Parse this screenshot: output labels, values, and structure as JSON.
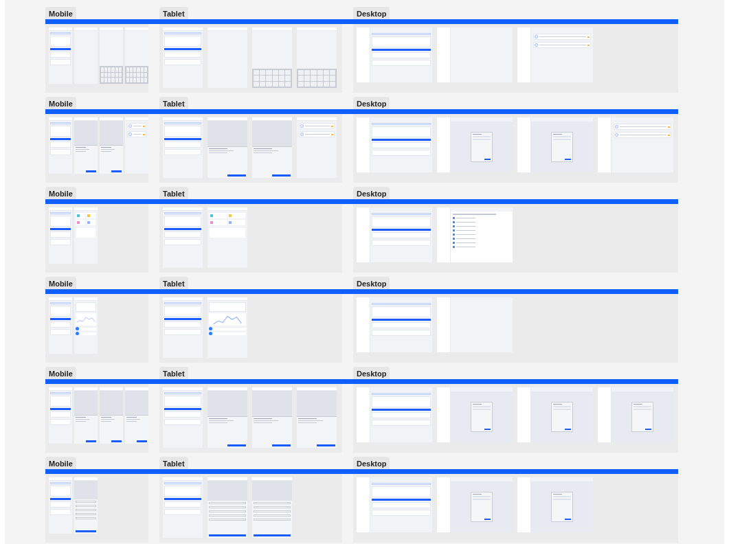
{
  "rows": [
    {
      "sections": [
        {
          "label": "Mobile",
          "kind": "mobile",
          "frames": [
            {
              "kind": "list"
            },
            {
              "kind": "empty"
            },
            {
              "kind": "keyboard"
            },
            {
              "kind": "keyboard"
            }
          ]
        },
        {
          "label": "Tablet",
          "kind": "tablet",
          "frames": [
            {
              "kind": "list"
            },
            {
              "kind": "empty"
            },
            {
              "kind": "keyboard"
            },
            {
              "kind": "keyboard"
            }
          ]
        },
        {
          "label": "Desktop",
          "kind": "desktop",
          "frames": [
            {
              "kind": "list"
            },
            {
              "kind": "empty"
            },
            {
              "kind": "results"
            }
          ]
        }
      ]
    },
    {
      "sections": [
        {
          "label": "Mobile",
          "kind": "mobile",
          "frames": [
            {
              "kind": "list"
            },
            {
              "kind": "sheet"
            },
            {
              "kind": "sheet"
            },
            {
              "kind": "results"
            }
          ]
        },
        {
          "label": "Tablet",
          "kind": "tablet",
          "frames": [
            {
              "kind": "list"
            },
            {
              "kind": "sheet"
            },
            {
              "kind": "sheet"
            },
            {
              "kind": "results"
            }
          ]
        },
        {
          "label": "Desktop",
          "kind": "desktop",
          "frames": [
            {
              "kind": "list"
            },
            {
              "kind": "dialog"
            },
            {
              "kind": "dialog"
            },
            {
              "kind": "results"
            }
          ]
        }
      ]
    },
    {
      "sections": [
        {
          "label": "Mobile",
          "kind": "mobile",
          "frames": [
            {
              "kind": "list"
            },
            {
              "kind": "home"
            }
          ]
        },
        {
          "label": "Tablet",
          "kind": "tablet",
          "frames": [
            {
              "kind": "list"
            },
            {
              "kind": "home"
            }
          ]
        },
        {
          "label": "Desktop",
          "kind": "desktop",
          "frames": [
            {
              "kind": "list"
            },
            {
              "kind": "document"
            }
          ]
        }
      ]
    },
    {
      "sections": [
        {
          "label": "Mobile",
          "kind": "mobile",
          "frames": [
            {
              "kind": "list"
            },
            {
              "kind": "chart"
            }
          ]
        },
        {
          "label": "Tablet",
          "kind": "tablet",
          "frames": [
            {
              "kind": "list"
            },
            {
              "kind": "chart"
            }
          ]
        },
        {
          "label": "Desktop",
          "kind": "desktop",
          "frames": [
            {
              "kind": "list"
            },
            {
              "kind": "blank"
            }
          ]
        }
      ]
    },
    {
      "sections": [
        {
          "label": "Mobile",
          "kind": "mobile",
          "frames": [
            {
              "kind": "list"
            },
            {
              "kind": "sheet"
            },
            {
              "kind": "sheet"
            },
            {
              "kind": "sheet"
            }
          ]
        },
        {
          "label": "Tablet",
          "kind": "tablet",
          "frames": [
            {
              "kind": "list"
            },
            {
              "kind": "sheet"
            },
            {
              "kind": "sheet"
            },
            {
              "kind": "sheet"
            }
          ]
        },
        {
          "label": "Desktop",
          "kind": "desktop",
          "frames": [
            {
              "kind": "list"
            },
            {
              "kind": "dialog"
            },
            {
              "kind": "dialog"
            },
            {
              "kind": "dialog"
            }
          ]
        }
      ]
    },
    {
      "sections": [
        {
          "label": "Mobile",
          "kind": "mobile",
          "frames": [
            {
              "kind": "list"
            },
            {
              "kind": "form"
            }
          ]
        },
        {
          "label": "Tablet",
          "kind": "tablet",
          "frames": [
            {
              "kind": "list"
            },
            {
              "kind": "form"
            },
            {
              "kind": "form"
            }
          ]
        },
        {
          "label": "Desktop",
          "kind": "desktop",
          "frames": [
            {
              "kind": "list"
            },
            {
              "kind": "dialog"
            },
            {
              "kind": "dialog"
            }
          ]
        }
      ]
    }
  ]
}
